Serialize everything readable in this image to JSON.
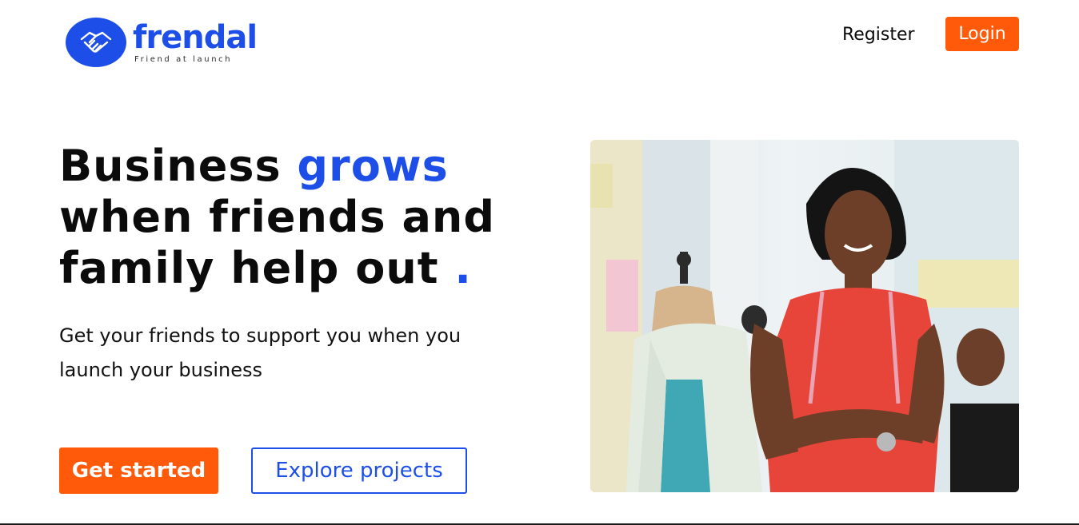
{
  "brand": {
    "name": "frendal",
    "tagline": "Friend at launch",
    "color": "#1d4fe8"
  },
  "nav": {
    "register_label": "Register",
    "login_label": "Login"
  },
  "hero": {
    "headline_part1": "Business ",
    "headline_accent": "grows",
    "headline_part2": " when friends and family help out ",
    "headline_dot": ".",
    "subtext": "Get your friends to support you when you launch your business",
    "primary_cta": "Get started",
    "secondary_cta": "Explore projects"
  },
  "colors": {
    "accent_blue": "#1d4fe8",
    "cta_orange": "#ff5a0a"
  },
  "icons": {
    "logo": "handshake-icon"
  }
}
